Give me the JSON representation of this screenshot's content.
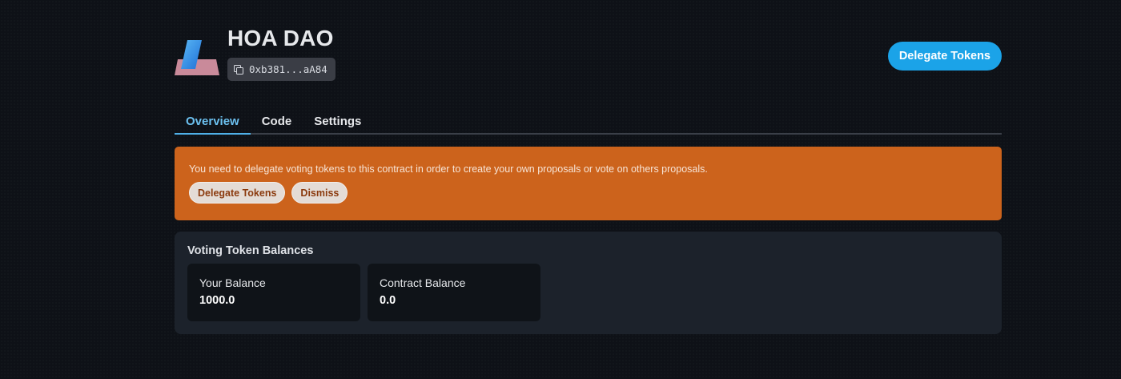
{
  "header": {
    "title": "HOA DAO",
    "address": "0xb381...aA84",
    "delegate_button": "Delegate Tokens"
  },
  "tabs": [
    {
      "label": "Overview",
      "active": true
    },
    {
      "label": "Code",
      "active": false
    },
    {
      "label": "Settings",
      "active": false
    }
  ],
  "alert": {
    "message": "You need to delegate voting tokens to this contract in order to create your own proposals or vote on others proposals.",
    "delegate_button": "Delegate Tokens",
    "dismiss_button": "Dismiss"
  },
  "balances": {
    "title": "Voting Token Balances",
    "cards": [
      {
        "label": "Your Balance",
        "value": "1000.0"
      },
      {
        "label": "Contract Balance",
        "value": "0.0"
      }
    ]
  },
  "colors": {
    "background": "#0e1117",
    "accent": "#1ba3e8",
    "alert": "#cc631c",
    "panel": "#1c222b"
  }
}
